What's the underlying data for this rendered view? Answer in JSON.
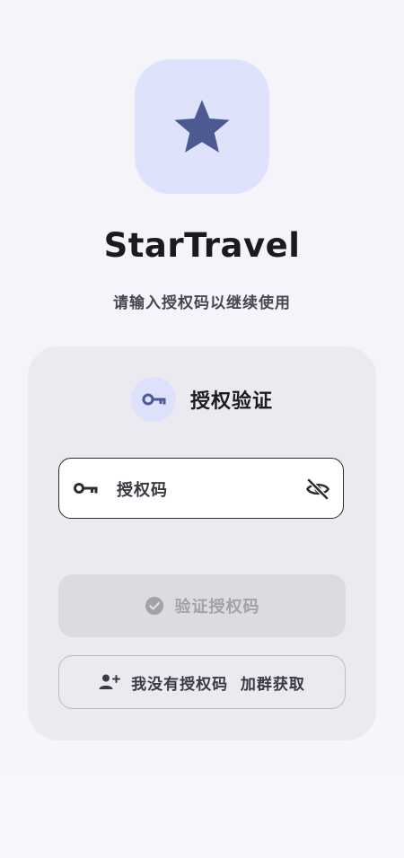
{
  "app": {
    "logo_icon": "star-icon",
    "title": "StarTravel",
    "subtitle": "请输入授权码以继续使用"
  },
  "card": {
    "header_icon": "key-icon",
    "title": "授权验证",
    "input": {
      "leading_icon": "key-icon",
      "placeholder": "授权码",
      "value": "",
      "trailing_icon": "eye-off-icon"
    },
    "verify_button": {
      "icon": "check-circle-icon",
      "label": "验证授权码",
      "enabled": false
    },
    "no_code_button": {
      "icon": "person-add-icon",
      "label": "我没有授权码  加群获取"
    }
  },
  "colors": {
    "accent": "#4d5a92",
    "logo_tile": "#dfe2fb",
    "card_bg": "#eceaf1",
    "disabled_button": "#dcdbe0"
  }
}
